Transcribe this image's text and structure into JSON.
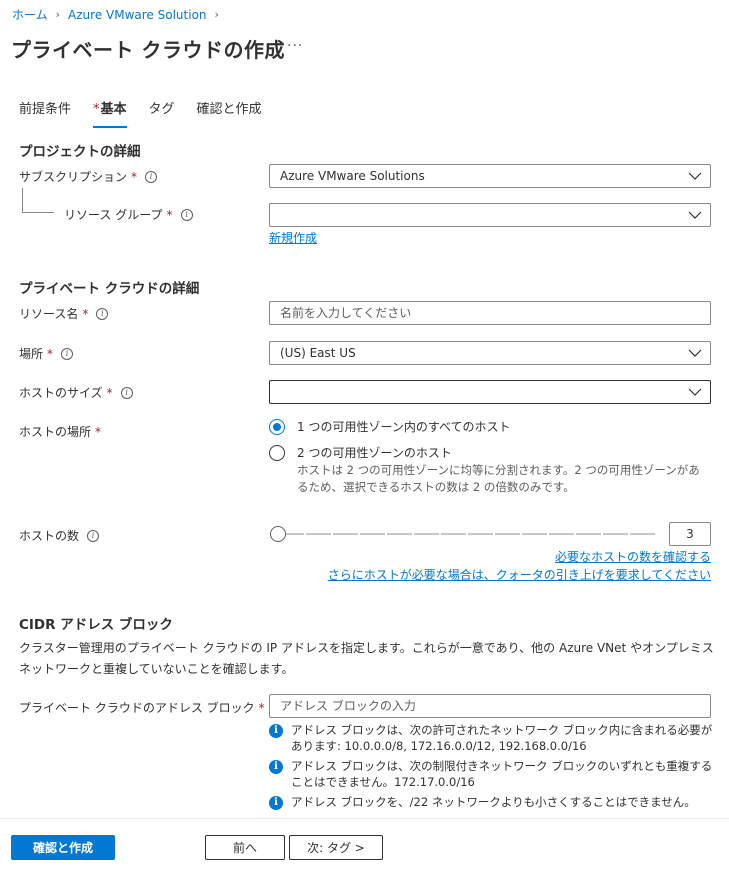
{
  "breadcrumb": {
    "home": "ホーム",
    "service": "Azure VMware Solution"
  },
  "page": {
    "title": "プライベート クラウドの作成",
    "more": "···"
  },
  "tabs": [
    {
      "label": "前提条件",
      "required": false,
      "active": false
    },
    {
      "label": "基本",
      "required": true,
      "active": true
    },
    {
      "label": "タグ",
      "required": false,
      "active": false
    },
    {
      "label": "確認と作成",
      "required": false,
      "active": false
    }
  ],
  "project": {
    "title": "プロジェクトの詳細",
    "subscription_label": "サブスクリプション",
    "subscription_value": "Azure VMware Solutions",
    "resource_group_label": "リソース グループ",
    "resource_group_value": "",
    "create_new": "新規作成"
  },
  "cloud": {
    "title": "プライベート クラウドの詳細",
    "resource_name_label": "リソース名",
    "resource_name_placeholder": "名前を入力してください",
    "location_label": "場所",
    "location_value": "(US) East US",
    "host_size_label": "ホストのサイズ",
    "host_size_value": "",
    "host_location_label": "ホストの場所",
    "host_location_options": [
      {
        "label": "1 つの可用性ゾーン内のすべてのホスト",
        "checked": true
      },
      {
        "label": "2 つの可用性ゾーンのホスト",
        "checked": false,
        "description": "ホストは 2 つの可用性ゾーンに均等に分割されます。2 つの可用性ゾーンがあるため、選択できるホストの数は 2 の倍数のみです。"
      }
    ],
    "host_count_label": "ホストの数",
    "host_count_value": "3",
    "host_count_fraction": 0.0,
    "check_hosts_link": "必要なホストの数を確認する",
    "quota_link": "さらにホストが必要な場合は、クォータの引き上げを要求してください"
  },
  "cidr": {
    "title": "CIDR アドレス ブロック",
    "description": "クラスター管理用のプライベート クラウドの IP アドレスを指定します。これらが一意であり、他の Azure VNet やオンプレミス ネットワークと重複していないことを確認します。",
    "address_block_label": "プライベート クラウドのアドレス ブロック",
    "address_block_placeholder": "アドレス ブロックの入力",
    "notes": [
      "アドレス ブロックは、次の許可されたネットワーク ブロック内に含まれる必要があります: 10.0.0.0/8, 172.16.0.0/12, 192.168.0.0/16",
      "アドレス ブロックは、次の制限付きネットワーク ブロックのいずれとも重複することはできません。172.17.0.0/16",
      "アドレス ブロックを、/22 ネットワークよりも小さくすることはできません。"
    ]
  },
  "footer": {
    "review_create": "確認と作成",
    "previous": "前へ",
    "next": "次: タグ >"
  },
  "colors": {
    "accent": "#0078d4",
    "required": "#a4262c",
    "text": "#323130"
  }
}
